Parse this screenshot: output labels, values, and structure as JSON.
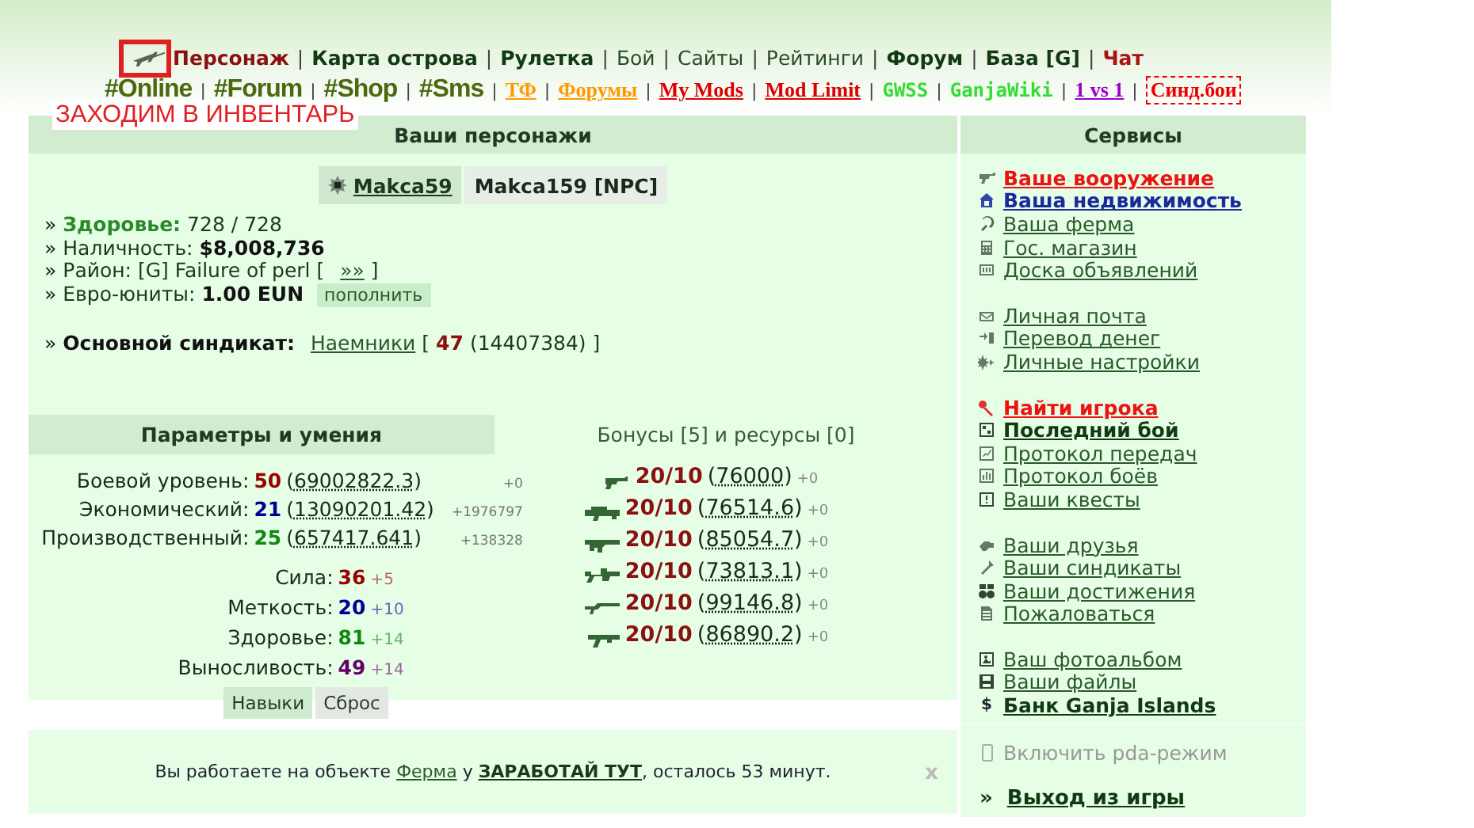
{
  "nav": {
    "separator": "|",
    "primary": [
      {
        "label": "Персонаж",
        "kind": "active"
      },
      {
        "label": "Карта острова",
        "kind": "bold"
      },
      {
        "label": "Рулетка",
        "kind": "bold"
      },
      {
        "label": "Бой",
        "kind": "plain"
      },
      {
        "label": "Сайты",
        "kind": "plain"
      },
      {
        "label": "Рейтинги",
        "kind": "plain"
      },
      {
        "label": "Форум",
        "kind": "bold"
      },
      {
        "label": "База [G]",
        "kind": "bold"
      },
      {
        "label": "Чат",
        "kind": "alert"
      }
    ],
    "secondary": [
      {
        "label": "#Online",
        "kind": "hash"
      },
      {
        "label": "#Forum",
        "kind": "hash"
      },
      {
        "label": "#Shop",
        "kind": "hash"
      },
      {
        "label": "#Sms",
        "kind": "hash"
      },
      {
        "label": "ТФ",
        "kind": "link",
        "color": "#ff9900"
      },
      {
        "label": "Форумы",
        "kind": "link",
        "color": "#ff9900"
      },
      {
        "label": "My Mods",
        "kind": "link",
        "color": "#dd0000"
      },
      {
        "label": "Mod Limit",
        "kind": "link",
        "color": "#dd0000"
      },
      {
        "label": "GWSS",
        "kind": "plain",
        "color": "#33dd33"
      },
      {
        "label": "GanjaWiki",
        "kind": "plain",
        "color": "#33dd33"
      },
      {
        "label": "1 vs 1",
        "kind": "link",
        "color": "#9900cc"
      },
      {
        "label": "Синд.бои",
        "kind": "boxed",
        "color": "#ee0000"
      }
    ]
  },
  "annotation": {
    "text": "ЗАХОДИМ В ИНВЕНТАРЬ"
  },
  "characters": {
    "title": "Ваши персонажи",
    "bullet": "»",
    "list": [
      {
        "name": "Makca59",
        "selected": true
      },
      {
        "name": "Makca159 [NPC]",
        "selected": false
      }
    ],
    "stats": [
      [
        {
          "text": "Здоровье:",
          "kind": "green"
        },
        {
          "text": "728 / 728",
          "kind": "plain"
        }
      ],
      [
        {
          "text": "Наличность:",
          "kind": "plain"
        },
        {
          "text": "$8,008,736",
          "kind": "bold"
        }
      ],
      [
        {
          "text": "Район: [G] Failure of perl [",
          "kind": "plain"
        },
        {
          "text": "»»",
          "kind": "link"
        },
        {
          "text": "]",
          "kind": "plain"
        }
      ],
      [
        {
          "text": "Евро-юниты:",
          "kind": "plain"
        },
        {
          "text": "1.00 EUN",
          "kind": "bold"
        },
        {
          "text": "пополнить",
          "kind": "button"
        }
      ],
      [
        {
          "text": "Основной синдикат:",
          "kind": "bold"
        },
        {
          "text": "Наемники",
          "kind": "link"
        },
        {
          "text": "[",
          "kind": "plain"
        },
        {
          "text": "47",
          "kind": "red"
        },
        {
          "text": "(14407384) ]",
          "kind": "plain"
        }
      ]
    ]
  },
  "tabs": [
    {
      "label": "Параметры и умения",
      "selected": true
    },
    {
      "label": "Бонусы [5] и ресурсы [0]",
      "selected": false
    }
  ],
  "levels": [
    {
      "label": "Боевой уровень:",
      "value": "50",
      "exp": "(69002822.3)",
      "delta": "+0",
      "color": "#990000"
    },
    {
      "label": "Экономический:",
      "value": "21",
      "exp": "(13090201.42)",
      "delta": "+1976797",
      "color": "#000099"
    },
    {
      "label": "Производственный:",
      "value": "25",
      "exp": "(657417.641)",
      "delta": "+138328",
      "color": "#118811"
    }
  ],
  "attributes": [
    {
      "label": "Сила:",
      "value": "36",
      "bonus": "+5",
      "color": "#990000"
    },
    {
      "label": "Меткость:",
      "value": "20",
      "bonus": "+10",
      "color": "#000099"
    },
    {
      "label": "Здоровье:",
      "value": "81",
      "bonus": "+14",
      "color": "#118811"
    },
    {
      "label": "Выносливость:",
      "value": "49",
      "bonus": "+14",
      "color": "#660066"
    }
  ],
  "skill_buttons": [
    {
      "label": "Навыки",
      "selected": true
    },
    {
      "label": "Сброс",
      "selected": false
    }
  ],
  "bonuses": [
    {
      "value": "20/10",
      "exp": "(76000)",
      "delta": "+0"
    },
    {
      "value": "20/10",
      "exp": "(76514.6)",
      "delta": "+0"
    },
    {
      "value": "20/10",
      "exp": "(85054.7)",
      "delta": "+0"
    },
    {
      "value": "20/10",
      "exp": "(73813.1)",
      "delta": "+0"
    },
    {
      "value": "20/10",
      "exp": "(99146.8)",
      "delta": "+0"
    },
    {
      "value": "20/10",
      "exp": "(86890.2)",
      "delta": "+0"
    }
  ],
  "services": {
    "title": "Сервисы",
    "groups": [
      [
        {
          "label": "Ваше вооружение",
          "kind": "red"
        },
        {
          "label": "Ваша недвижимость",
          "kind": "blue"
        },
        {
          "label": "Ваша ферма",
          "kind": "plain"
        },
        {
          "label": "Гос. магазин",
          "kind": "plain"
        },
        {
          "label": "Доска объявлений",
          "kind": "plain"
        }
      ],
      [
        {
          "label": "Личная почта",
          "kind": "plain"
        },
        {
          "label": "Перевод денег",
          "kind": "plain"
        },
        {
          "label": "Личные настройки",
          "kind": "plain"
        }
      ],
      [
        {
          "label": "Найти игрока",
          "kind": "red"
        },
        {
          "label": "Последний бой",
          "kind": "bold"
        },
        {
          "label": "Протокол передач",
          "kind": "plain"
        },
        {
          "label": "Протокол боёв",
          "kind": "plain"
        },
        {
          "label": "Ваши квесты",
          "kind": "plain"
        }
      ],
      [
        {
          "label": "Ваши друзья",
          "kind": "plain"
        },
        {
          "label": "Ваши синдикаты",
          "kind": "plain"
        },
        {
          "label": "Ваши достижения",
          "kind": "plain"
        },
        {
          "label": "Пожаловаться",
          "kind": "plain"
        }
      ],
      [
        {
          "label": "Ваш фотоальбом",
          "kind": "plain"
        },
        {
          "label": "Ваши файлы",
          "kind": "plain"
        },
        {
          "label": "Банк Ganja Islands",
          "kind": "bold",
          "icon_char": "$"
        }
      ]
    ],
    "pda": {
      "label": "Включить pda-режим",
      "disabled": true
    },
    "logout": {
      "bullet": "»",
      "label": "Выход из игры"
    }
  },
  "notice": {
    "parts": [
      {
        "text": "Вы работаете на объекте ",
        "kind": "text"
      },
      {
        "text": "Ферма",
        "kind": "link"
      },
      {
        "text": " у ",
        "kind": "text"
      },
      {
        "text": "ЗАРАБОТАЙ ТУТ",
        "kind": "strong-link"
      },
      {
        "text": ", осталось 53 минут.",
        "kind": "text"
      }
    ],
    "close": "x"
  }
}
